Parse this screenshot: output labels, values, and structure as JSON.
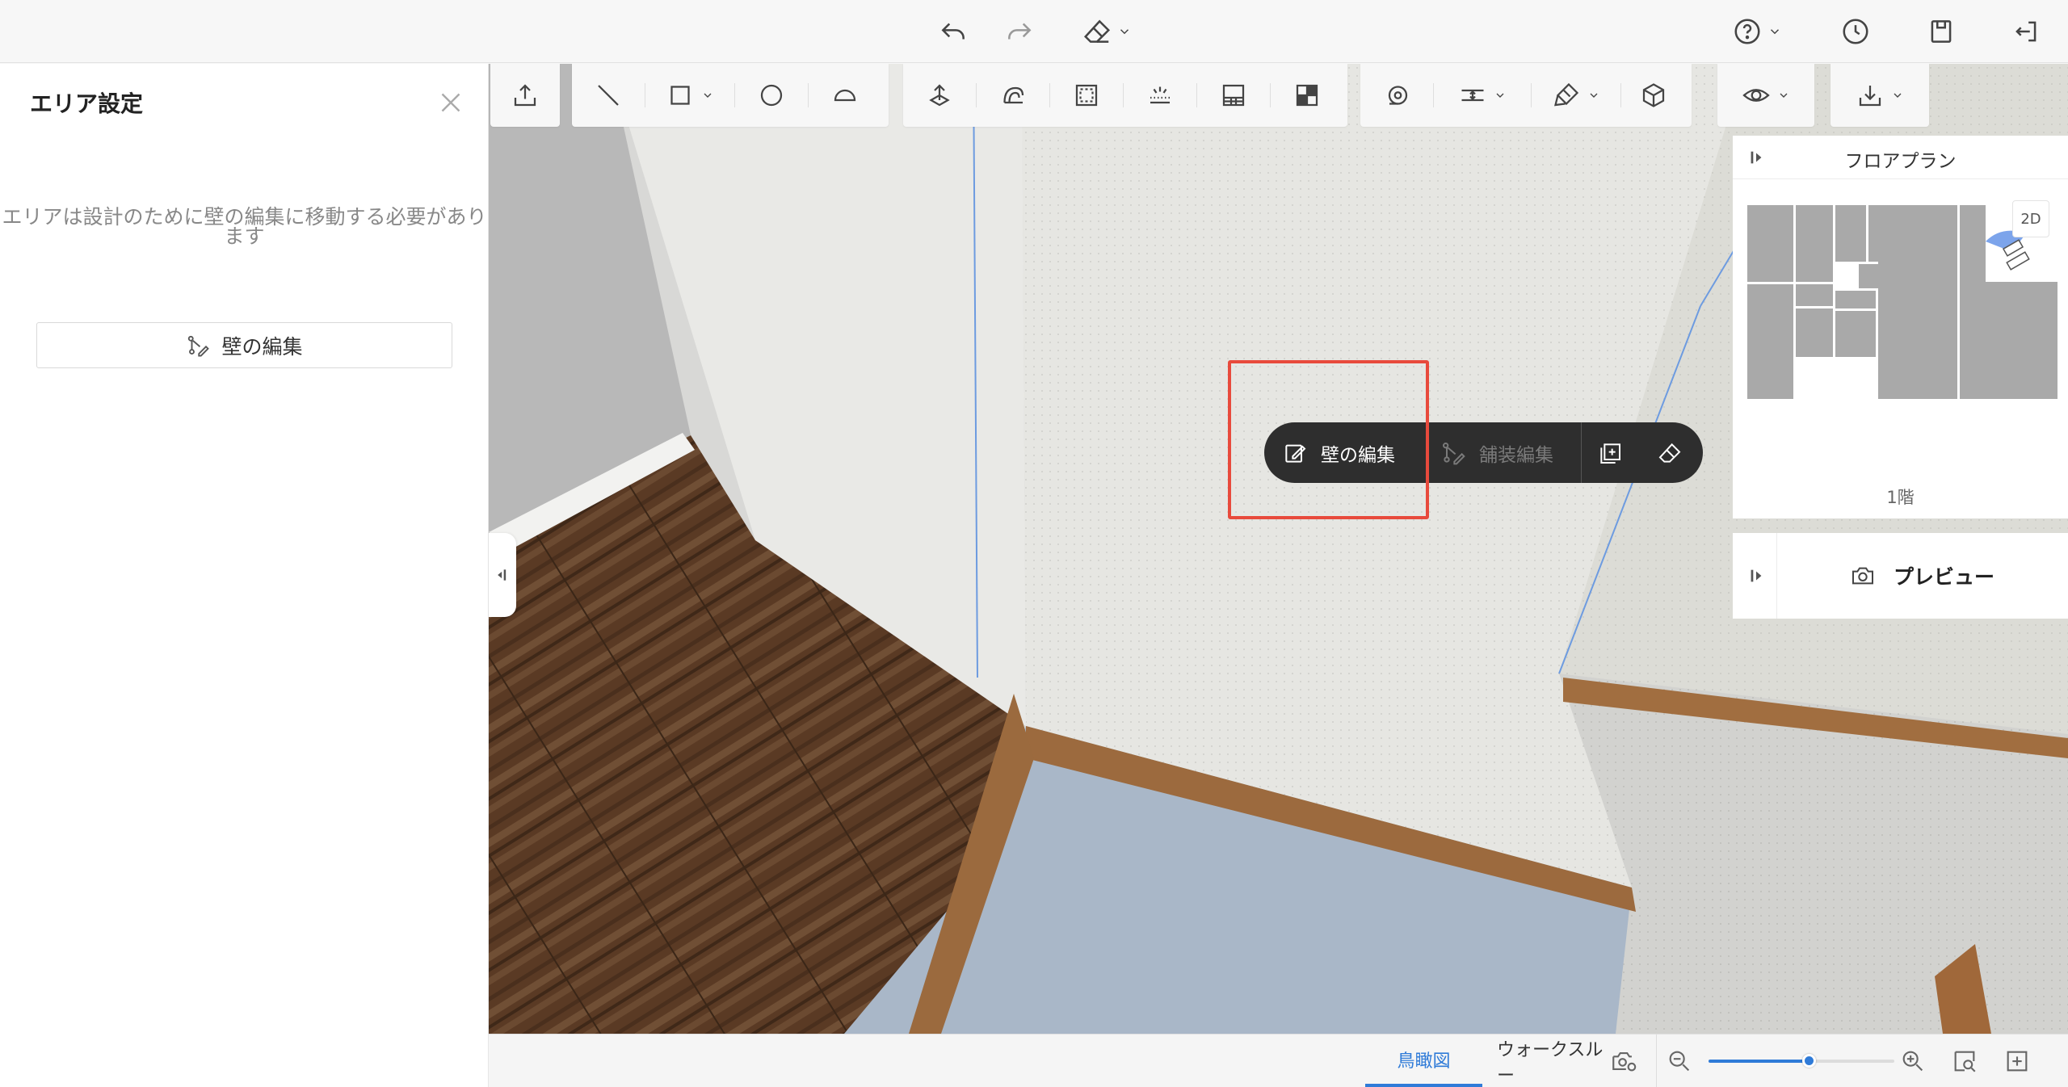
{
  "topbar": {
    "undo_icon": "undo-icon",
    "redo_icon": "redo-icon",
    "eraser_icon": "eraser-icon",
    "help_icon": "help-icon",
    "history_icon": "clock-icon",
    "save_icon": "save-icon",
    "exit_icon": "exit-icon"
  },
  "left_panel": {
    "title": "エリア設定",
    "message_line1": "エリアは設計のために壁の編集に移動する必要があり",
    "message_line2": "ます",
    "button_label": "壁の編集"
  },
  "toolbar": {
    "groups": [
      [
        "upload-icon"
      ],
      [
        "line-icon",
        "rectangle-icon",
        "circle-icon",
        "arc-icon"
      ],
      [
        "move-up-icon",
        "sweep-icon",
        "region-icon",
        "lighting-icon",
        "wall-panel-icon",
        "split-icon"
      ],
      [
        "tape-icon",
        "align-icon",
        "brush-icon",
        "cube-icon"
      ],
      [
        "eye-icon"
      ],
      [
        "download-icon"
      ]
    ]
  },
  "floorplan": {
    "title": "フロアプラン",
    "mode_label": "2D",
    "floor_label": "1階"
  },
  "preview": {
    "label": "プレビュー"
  },
  "context_menu": {
    "edit_wall": "壁の編集",
    "edit_paving": "舗装編集"
  },
  "bottombar": {
    "tab_birdseye": "鳥瞰図",
    "tab_walkthrough": "ウォークスルー",
    "zoom_level": 0.55
  },
  "colors": {
    "accent": "#2f7bd8",
    "highlight": "#e84a3c",
    "context_bg": "#2e2e2e"
  }
}
